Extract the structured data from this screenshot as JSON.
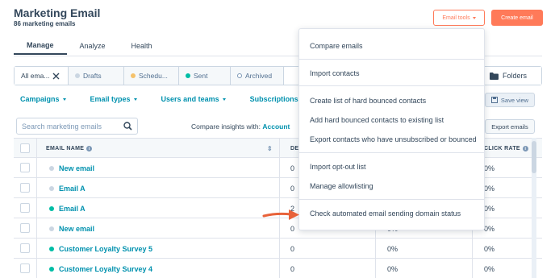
{
  "header": {
    "title": "Marketing Email",
    "subtitle": "86 marketing emails",
    "email_tools_label": "Email tools",
    "create_label": "Create email"
  },
  "tabs": [
    {
      "label": "Manage",
      "active": true
    },
    {
      "label": "Analyze",
      "active": false
    },
    {
      "label": "Health",
      "active": false
    }
  ],
  "views": [
    {
      "label": "All ema...",
      "active": true
    },
    {
      "label": "Drafts",
      "dot_color": "#cbd6e2"
    },
    {
      "label": "Schedu...",
      "dot_color": "#f5c26b"
    },
    {
      "label": "Sent",
      "dot_color": "#00bda5"
    },
    {
      "label": "Archived",
      "dot_color": "#ffffff"
    }
  ],
  "folders_label": "Folders",
  "filters": [
    "Campaigns",
    "Email types",
    "Users and teams",
    "Subscriptions"
  ],
  "save_view_label": "Save view",
  "search": {
    "placeholder": "Search marketing emails"
  },
  "compare": {
    "label": "Compare insights with:",
    "value": "Account"
  },
  "export_label": "Export emails",
  "table": {
    "columns": {
      "name": "EMAIL NAME",
      "delivered": "DE",
      "click_rate": "CLICK RATE"
    },
    "rows": [
      {
        "name": "New email",
        "delivered": "0",
        "open": "",
        "click": "0%",
        "dot_color": "#cbd6e2"
      },
      {
        "name": "Email A",
        "delivered": "0",
        "open": "",
        "click": "0%",
        "dot_color": "#cbd6e2"
      },
      {
        "name": "Email A",
        "delivered": "2",
        "open": "",
        "click": "0%",
        "dot_color": "#00bda5"
      },
      {
        "name": "New email",
        "delivered": "0",
        "open": "0%",
        "click": "0%",
        "dot_color": "#cbd6e2"
      },
      {
        "name": "Customer Loyalty Survey 5",
        "delivered": "0",
        "open": "0%",
        "click": "0%",
        "dot_color": "#00bda5"
      },
      {
        "name": "Customer Loyalty Survey 4",
        "delivered": "0",
        "open": "0%",
        "click": "0%",
        "dot_color": "#00bda5"
      }
    ]
  },
  "dropdown": {
    "groups": [
      [
        "Compare emails"
      ],
      [
        "Import contacts"
      ],
      [
        "Create list of hard bounced contacts",
        "Add hard bounced contacts to existing list",
        "Export contacts who have unsubscribed or bounced"
      ],
      [
        "Import opt-out list",
        "Manage allowlisting"
      ],
      [
        "Check automated email sending domain status"
      ]
    ]
  },
  "colors": {
    "accent": "#ff7a59",
    "link": "#0091ae",
    "text": "#33475b",
    "arrow": "#e8623a"
  }
}
